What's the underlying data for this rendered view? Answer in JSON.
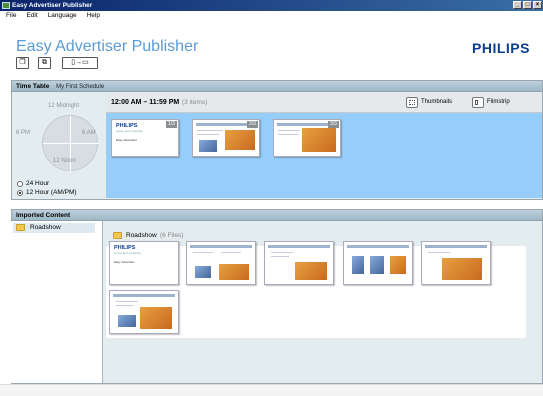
{
  "window": {
    "title": "Easy Advertiser Publisher"
  },
  "menu": [
    "File",
    "Edit",
    "Language",
    "Help"
  ],
  "app": {
    "title": "Easy Advertiser Publisher",
    "brand": "PHILIPS"
  },
  "toolbar": {
    "open_label": "❐",
    "copy_label": "⧉",
    "send_label": "▯→▭"
  },
  "timetable": {
    "header": "Time Table",
    "schedule_name": "My First Schedule",
    "clock": {
      "top": "12 Midnight",
      "left": "6 PM",
      "right": "6 AM",
      "bottom": "12 Noon"
    },
    "mode_24": "24 Hour",
    "mode_12": "12 Hour (AM/PM)",
    "range": "12:00 AM – 11:59 PM",
    "count": "(3 items)",
    "view_thumbnails": "Thumbnails",
    "view_filmstrip": "Filmstrip",
    "slides": [
      {
        "badge": "1/3",
        "brand": "PHILIPS",
        "tag": "sense and simplicity",
        "subtitle": "Easy Advertiser"
      },
      {
        "badge": "2/3"
      },
      {
        "badge": "3/3"
      }
    ]
  },
  "imported": {
    "header": "Imported Content",
    "folder": "Roadshow",
    "files_label": "(6 Files)",
    "thumbs": [
      {
        "brand": "PHILIPS",
        "tag": "sense and simplicity",
        "subtitle": "Easy Advertiser"
      }
    ]
  },
  "colors": {
    "accent": "#5b9bd5",
    "brand": "#0b3d91",
    "timetable_bg": "#97cdfa",
    "panel_bg": "#e3ecef"
  }
}
